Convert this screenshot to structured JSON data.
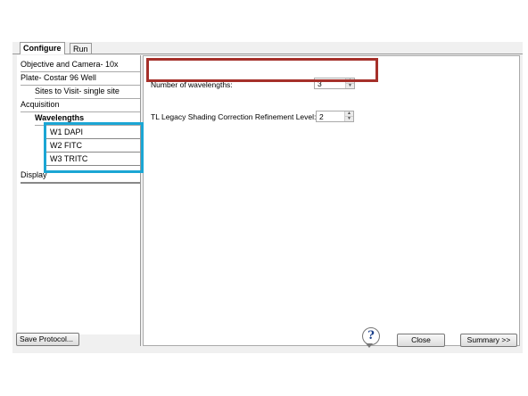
{
  "tabs": {
    "configure": "Configure",
    "run": "Run"
  },
  "sidebar": {
    "items": [
      "Objective and Camera- 10x",
      "Plate- Costar 96 Well",
      "Sites to Visit- single site",
      "Acquisition",
      "Wavelengths",
      "Display"
    ],
    "wavelengths": [
      "W1 DAPI",
      "W2 FITC",
      "W3 TRITC"
    ]
  },
  "panel": {
    "num_wavelengths_label": "Number of wavelengths:",
    "num_wavelengths_value": "3",
    "shading_label": "TL Legacy Shading Correction Refinement Level:",
    "shading_value": "2"
  },
  "footer": {
    "save_protocol": "Save Protocol...",
    "help": "?",
    "close": "Close",
    "summary": "Summary >>"
  },
  "colors": {
    "highlight_red": "#a5302a",
    "highlight_blue": "#1ba6d4"
  }
}
